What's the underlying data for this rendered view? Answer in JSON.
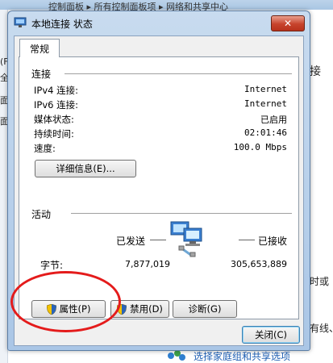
{
  "background": {
    "breadcrumbs": "  控制面板  ▸  所有控制面板项  ▸  网络和共享中心",
    "left_fragments": [
      "(F",
      "全",
      "面",
      "面"
    ],
    "right_fragments": [
      "接",
      "时或",
      "有线、"
    ],
    "bottom_link": "选择家庭组和共享选项"
  },
  "dialog": {
    "title": "本地连接 状态",
    "close_glyph": "✕",
    "tab_label": "常规",
    "connection": {
      "heading": "连接",
      "rows": [
        {
          "label": "IPv4 连接:",
          "value": "Internet"
        },
        {
          "label": "IPv6 连接:",
          "value": "Internet"
        },
        {
          "label": "媒体状态:",
          "value": "已启用"
        },
        {
          "label": "持续时间:",
          "value": "02:01:46"
        },
        {
          "label": "速度:",
          "value": "100.0 Mbps"
        }
      ],
      "details_button": "详细信息(E)..."
    },
    "activity": {
      "heading": "活动",
      "sent_label": "已发送",
      "received_label": "已接收",
      "bytes_label": "字节:",
      "sent_bytes": "7,877,019",
      "received_bytes": "305,653,889"
    },
    "buttons": {
      "properties": "属性(P)",
      "disable": "禁用(D)",
      "diagnose": "诊断(G)",
      "close": "关闭(C)"
    }
  },
  "colors": {
    "annotation_circle": "#e41b1b",
    "close_button": "#c7432c",
    "link": "#1e5fb4"
  }
}
